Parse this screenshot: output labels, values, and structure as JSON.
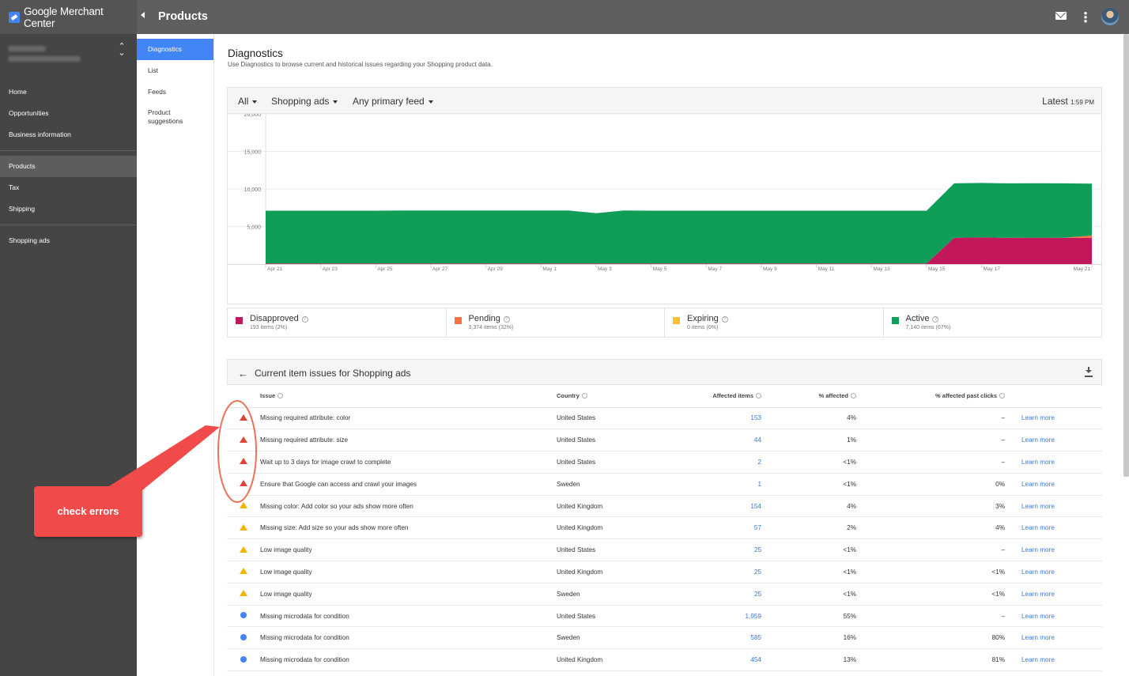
{
  "app": {
    "brand": "Google Merchant Center",
    "page_title": "Products"
  },
  "sidebar": {
    "items": [
      {
        "label": "Home"
      },
      {
        "label": "Opportunities"
      },
      {
        "label": "Business information"
      },
      {
        "label": "Products"
      },
      {
        "label": "Tax"
      },
      {
        "label": "Shipping"
      },
      {
        "label": "Shopping ads"
      }
    ]
  },
  "subnav": {
    "items": [
      {
        "label": "Diagnostics"
      },
      {
        "label": "List"
      },
      {
        "label": "Feeds"
      },
      {
        "label": "Product suggestions"
      }
    ]
  },
  "header": {
    "title": "Diagnostics",
    "description": "Use Diagnostics to browse current and historical issues regarding your Shopping product data."
  },
  "filters": {
    "all": "All",
    "destination": "Shopping ads",
    "feed": "Any primary feed",
    "latest_label": "Latest",
    "latest_time": "1:59 PM"
  },
  "chart_data": {
    "type": "area",
    "x": [
      "Apr 21",
      "Apr 22",
      "Apr 23",
      "Apr 24",
      "Apr 25",
      "Apr 26",
      "Apr 27",
      "Apr 28",
      "Apr 29",
      "Apr 30",
      "May 1",
      "May 2",
      "May 3",
      "May 4",
      "May 5",
      "May 6",
      "May 7",
      "May 8",
      "May 9",
      "May 10",
      "May 11",
      "May 12",
      "May 13",
      "May 14",
      "May 15",
      "May 16",
      "May 17",
      "May 18",
      "May 19",
      "May 20",
      "May 21"
    ],
    "x_tick_labels": [
      "Apr 21",
      "Apr 23",
      "Apr 25",
      "Apr 27",
      "Apr 29",
      "May 1",
      "May 3",
      "May 5",
      "May 7",
      "May 9",
      "May 11",
      "May 13",
      "May 15",
      "May 17",
      "May 21"
    ],
    "y_tick_labels": [
      "20,000",
      "15,000",
      "10,000",
      "5,000"
    ],
    "ylim": [
      0,
      20000
    ],
    "stacked": true,
    "series": [
      {
        "name": "Disapproved",
        "color": "#c2185b",
        "values": [
          80,
          80,
          80,
          80,
          80,
          80,
          80,
          80,
          80,
          80,
          80,
          80,
          80,
          80,
          80,
          80,
          80,
          80,
          80,
          80,
          80,
          80,
          80,
          80,
          80,
          3500,
          3550,
          3500,
          3520,
          3500,
          3500
        ]
      },
      {
        "name": "Pending",
        "color": "#ff7043",
        "values": [
          0,
          0,
          0,
          0,
          0,
          0,
          0,
          0,
          0,
          0,
          0,
          0,
          0,
          0,
          0,
          0,
          0,
          0,
          0,
          0,
          0,
          0,
          0,
          0,
          0,
          0,
          0,
          0,
          0,
          0,
          300
        ]
      },
      {
        "name": "Expiring",
        "color": "#fbc02d",
        "values": [
          0,
          0,
          0,
          0,
          0,
          0,
          0,
          0,
          0,
          0,
          0,
          0,
          0,
          0,
          0,
          0,
          0,
          0,
          0,
          0,
          0,
          0,
          0,
          0,
          0,
          0,
          0,
          0,
          0,
          0,
          0
        ]
      },
      {
        "name": "Active",
        "color": "#0f9d58",
        "values": [
          7020,
          7020,
          7020,
          7020,
          7020,
          7050,
          7050,
          7050,
          7050,
          7050,
          7050,
          7050,
          6700,
          7050,
          7030,
          7030,
          7030,
          7030,
          7030,
          7030,
          7030,
          7030,
          7030,
          7030,
          7030,
          7250,
          7250,
          7250,
          7250,
          7250,
          6900
        ]
      }
    ]
  },
  "legend": [
    {
      "label": "Disapproved",
      "sub": "193 items (2%)",
      "color": "#c2185b"
    },
    {
      "label": "Pending",
      "sub": "3,374 items (32%)",
      "color": "#ff7043"
    },
    {
      "label": "Expiring",
      "sub": "0 items (0%)",
      "color": "#fbc02d"
    },
    {
      "label": "Active",
      "sub": "7,140 items (67%)",
      "color": "#0f9d58"
    }
  ],
  "issues": {
    "title": "Current item issues for Shopping ads",
    "columns": {
      "issue": "Issue",
      "country": "Country",
      "affected": "Affected items",
      "pct": "% affected",
      "clicks": "% affected past clicks"
    },
    "learn_label": "Learn more",
    "rows": [
      {
        "severity": "error",
        "issue": "Missing required attribute: color",
        "country": "United States",
        "affected": "153",
        "pct": "4%",
        "clicks": "–"
      },
      {
        "severity": "error",
        "issue": "Missing required attribute: size",
        "country": "United States",
        "affected": "44",
        "pct": "1%",
        "clicks": "–"
      },
      {
        "severity": "error",
        "issue": "Wait up to 3 days for image crawl to complete",
        "country": "United States",
        "affected": "2",
        "pct": "<1%",
        "clicks": "–"
      },
      {
        "severity": "error",
        "issue": "Ensure that Google can access and crawl your images",
        "country": "Sweden",
        "affected": "1",
        "pct": "<1%",
        "clicks": "0%"
      },
      {
        "severity": "warning",
        "issue": "Missing color: Add color so your ads show more often",
        "country": "United Kingdom",
        "affected": "154",
        "pct": "4%",
        "clicks": "3%"
      },
      {
        "severity": "warning",
        "issue": "Missing size: Add size so your ads show more often",
        "country": "United Kingdom",
        "affected": "57",
        "pct": "2%",
        "clicks": "4%"
      },
      {
        "severity": "warning",
        "issue": "Low image quality",
        "country": "United States",
        "affected": "25",
        "pct": "<1%",
        "clicks": "–"
      },
      {
        "severity": "warning",
        "issue": "Low image quality",
        "country": "United Kingdom",
        "affected": "25",
        "pct": "<1%",
        "clicks": "<1%"
      },
      {
        "severity": "warning",
        "issue": "Low image quality",
        "country": "Sweden",
        "affected": "25",
        "pct": "<1%",
        "clicks": "<1%"
      },
      {
        "severity": "info",
        "issue": "Missing microdata for condition",
        "country": "United States",
        "affected": "1,959",
        "pct": "55%",
        "clicks": "–"
      },
      {
        "severity": "info",
        "issue": "Missing microdata for condition",
        "country": "Sweden",
        "affected": "585",
        "pct": "16%",
        "clicks": "80%"
      },
      {
        "severity": "info",
        "issue": "Missing microdata for condition",
        "country": "United Kingdom",
        "affected": "454",
        "pct": "13%",
        "clicks": "81%"
      }
    ]
  },
  "annotation": {
    "label": "check errors",
    "color": "#f04a4a"
  }
}
